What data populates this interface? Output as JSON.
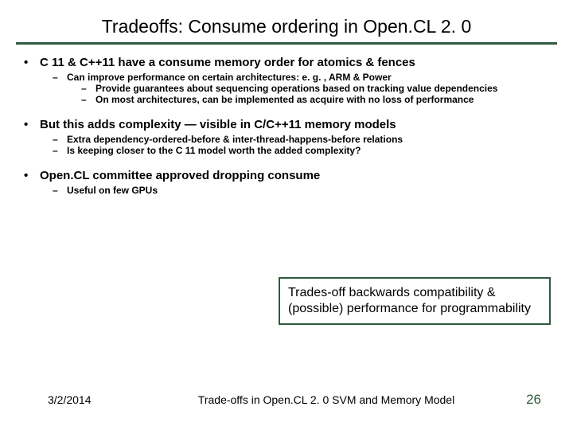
{
  "title": "Tradeoffs: Consume ordering in Open.CL 2. 0",
  "bullets": [
    {
      "text": "C 11 & C++11 have a consume memory order for atomics & fences",
      "sub1": [
        {
          "text": "Can improve performance on certain architectures: e. g. , ARM & Power",
          "sub2": [
            "Provide guarantees about sequencing operations based on tracking value dependencies",
            "On most architectures, can be implemented as acquire with no loss of performance"
          ]
        }
      ]
    },
    {
      "text": "But this adds complexity — visible in C/C++11 memory models",
      "sub1": [
        {
          "text": "Extra dependency-ordered-before & inter-thread-happens-before relations"
        },
        {
          "text": "Is keeping closer to the C 11 model worth the added complexity?"
        }
      ]
    },
    {
      "text": "Open.CL committee approved dropping consume",
      "sub1": [
        {
          "text": "Useful on few GPUs"
        }
      ]
    }
  ],
  "callout": "Trades-off backwards compatibility & (possible) performance for programmability",
  "footer": {
    "date": "3/2/2014",
    "title": "Trade-offs in Open.CL 2. 0 SVM and Memory Model",
    "page": "26"
  }
}
